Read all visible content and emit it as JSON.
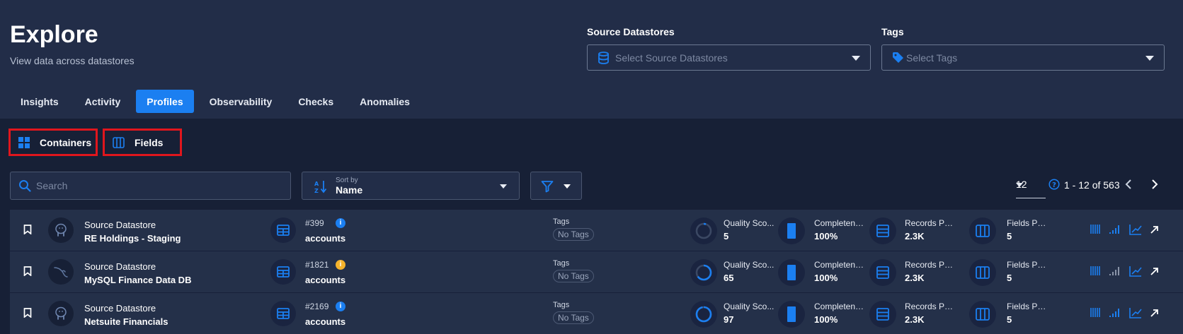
{
  "header": {
    "title": "Explore",
    "subtitle": "View data across datastores"
  },
  "filters": {
    "datastores": {
      "label": "Source Datastores",
      "placeholder": "Select Source Datastores"
    },
    "tags": {
      "label": "Tags",
      "placeholder": "Select Tags"
    }
  },
  "tabs": [
    "Insights",
    "Activity",
    "Profiles",
    "Observability",
    "Checks",
    "Anomalies"
  ],
  "active_tab": "Profiles",
  "view_toggle": {
    "containers": "Containers",
    "fields": "Fields"
  },
  "toolbar": {
    "search_placeholder": "Search",
    "sort_caption": "Sort by",
    "sort_value": "Name",
    "page_size": "12",
    "range": "1 - 12 of 563"
  },
  "rows": [
    {
      "ds_label": "Source Datastore",
      "ds_name": "RE Holdings - Staging",
      "ds_icon": "postgres-icon",
      "cont_id": "#399",
      "info_color": "#1b7ff1",
      "cont_name": "accounts",
      "tags_label": "Tags",
      "tags_value": "No Tags",
      "quality_label": "Quality Sco...",
      "quality_value": "5",
      "quality_score": 5,
      "completeness_label": "Completene...",
      "completeness_value": "100%",
      "records_label": "Records Profil...",
      "records_value": "2.3K",
      "fields_label": "Fields Profi",
      "fields_value": "5"
    },
    {
      "ds_label": "Source Datastore",
      "ds_name": "MySQL Finance Data DB",
      "ds_icon": "mysql-icon",
      "cont_id": "#1821",
      "info_color": "#f5b32c",
      "cont_name": "accounts",
      "tags_label": "Tags",
      "tags_value": "No Tags",
      "quality_label": "Quality Sco...",
      "quality_value": "65",
      "quality_score": 65,
      "completeness_label": "Completene...",
      "completeness_value": "100%",
      "records_label": "Records Profil...",
      "records_value": "2.3K",
      "fields_label": "Fields Profi",
      "fields_value": "5"
    },
    {
      "ds_label": "Source Datastore",
      "ds_name": "Netsuite Financials",
      "ds_icon": "postgres-icon",
      "cont_id": "#2169",
      "info_color": "#1b7ff1",
      "cont_name": "accounts",
      "tags_label": "Tags",
      "tags_value": "No Tags",
      "quality_label": "Quality Sco...",
      "quality_value": "97",
      "quality_score": 97,
      "completeness_label": "Completene...",
      "completeness_value": "100%",
      "records_label": "Records Profil...",
      "records_value": "2.3K",
      "fields_label": "Fields Profi",
      "fields_value": "5"
    }
  ],
  "colors": {
    "accent": "#1b7ff1",
    "highlight": "#e0161d"
  }
}
